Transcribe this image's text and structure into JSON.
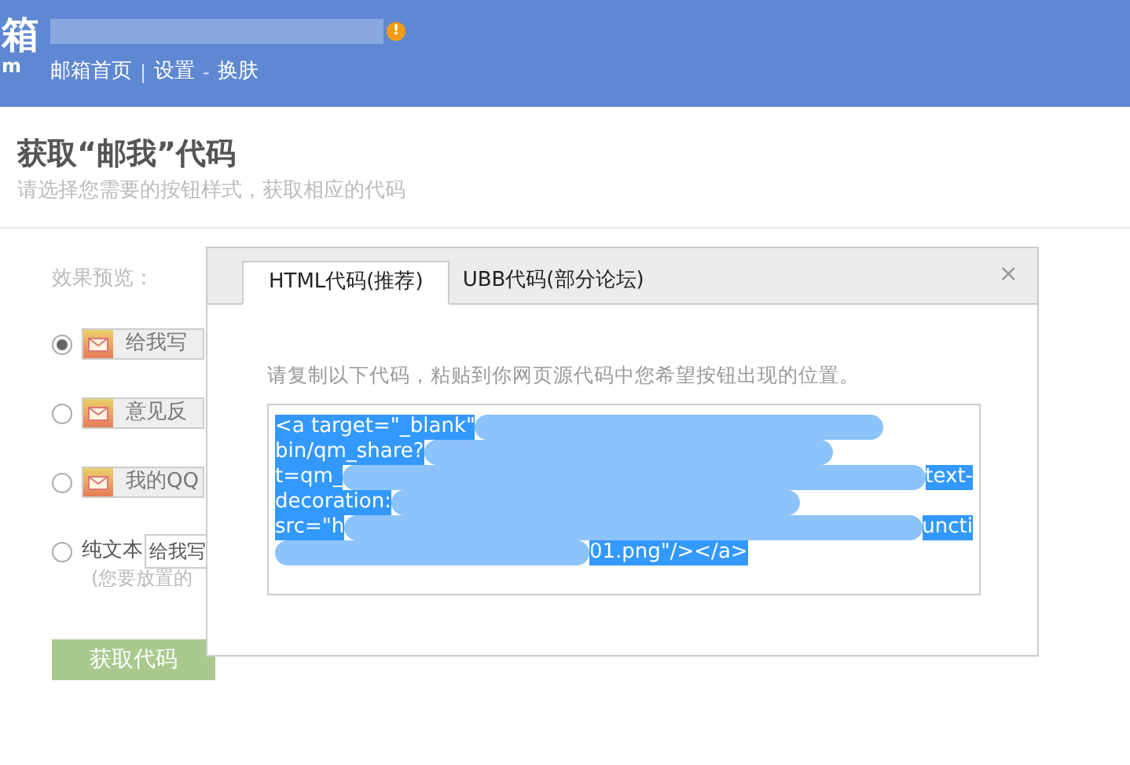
{
  "header": {
    "logo_char": "箱",
    "logo_suffix": "m",
    "alert_icon": "!",
    "nav": [
      {
        "label": "邮箱首页",
        "kind": "link"
      },
      {
        "label": "|",
        "kind": "sep"
      },
      {
        "label": "设置",
        "kind": "link"
      },
      {
        "label": "-",
        "kind": "sep"
      },
      {
        "label": "换肤",
        "kind": "link"
      }
    ]
  },
  "page": {
    "title": "获取“邮我”代码",
    "subtitle": "请选择您需要的按钮样式，获取相应的代码"
  },
  "preview": {
    "label": "效果预览：",
    "options": [
      {
        "kind": "button",
        "label": "给我写",
        "selected": true
      },
      {
        "kind": "button",
        "label": "意见反",
        "selected": false
      },
      {
        "kind": "button",
        "label": "我的QQ",
        "selected": false
      },
      {
        "kind": "text",
        "label": "纯文本",
        "value": "给我写",
        "selected": false
      }
    ],
    "note": "(您要放置的",
    "submit": "获取代码"
  },
  "dialog": {
    "tabs": [
      {
        "label": "HTML代码(推荐)",
        "selected": true
      },
      {
        "label": "UBB代码(部分论坛)",
        "selected": false
      }
    ],
    "close": "×",
    "instruction": "请复制以下代码，粘贴到你网页源代码中您希望按钮出现的位置。",
    "code_lines": [
      [
        {
          "kind": "text",
          "text": "<a target=\"_blank\""
        },
        {
          "kind": "blur"
        }
      ],
      [
        {
          "kind": "text",
          "text": "bin/qm_share?"
        },
        {
          "kind": "blur"
        }
      ],
      [
        {
          "kind": "text",
          "text": "t=qm_"
        },
        {
          "kind": "blur"
        },
        {
          "kind": "text",
          "text": "text-"
        }
      ],
      [
        {
          "kind": "text",
          "text": "decoration:"
        },
        {
          "kind": "blur"
        }
      ],
      [
        {
          "kind": "text",
          "text": "src=\"h"
        },
        {
          "kind": "blur"
        },
        {
          "kind": "text",
          "text": "uncti"
        }
      ],
      [
        {
          "kind": "blur"
        },
        {
          "kind": "text",
          "text": "01.png\"/></a>"
        }
      ]
    ]
  }
}
